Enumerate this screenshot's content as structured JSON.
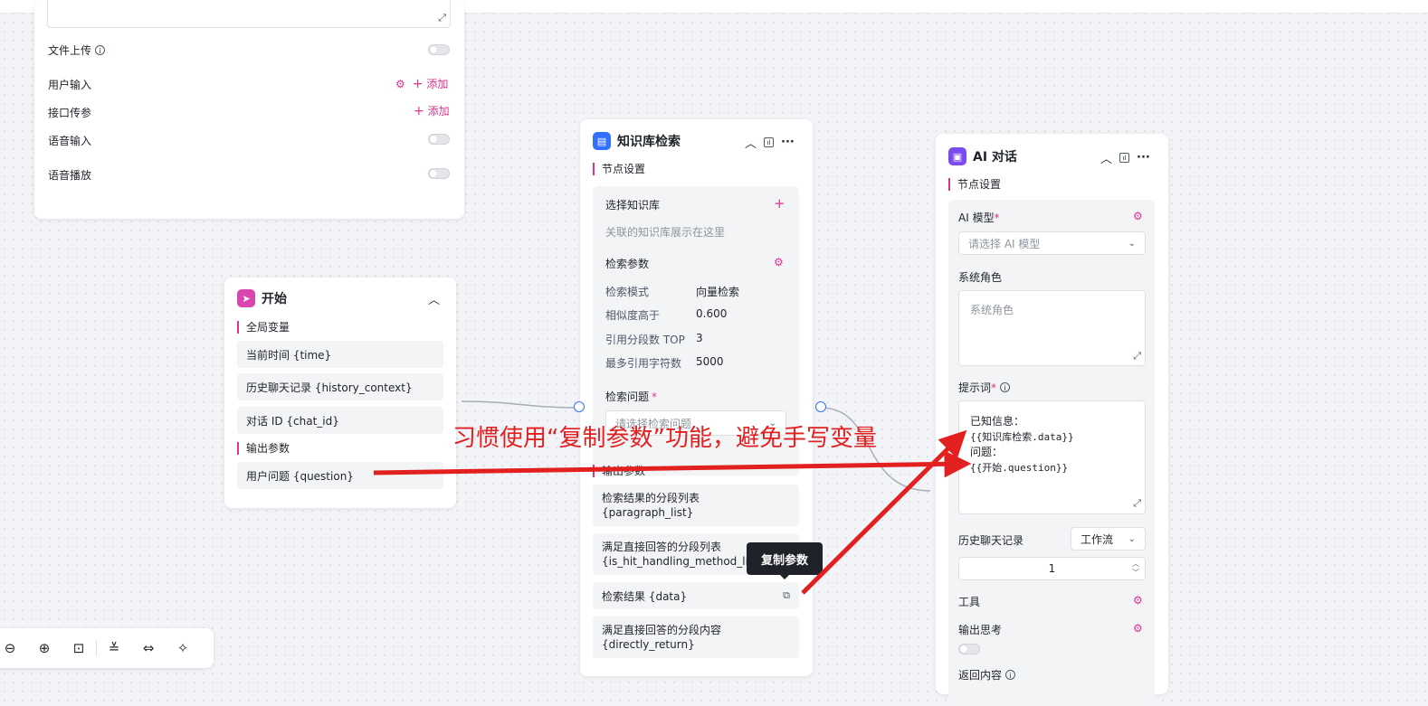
{
  "top_card": {
    "file_upload": "文件上传",
    "user_input": "用户输入",
    "api_params": "接口传参",
    "add": "添加",
    "voice_input": "语音输入",
    "voice_play": "语音播放"
  },
  "start_node": {
    "title": "开始",
    "global_vars": "全局变量",
    "vars": [
      "当前时间 {time}",
      "历史聊天记录 {history_context}",
      "对话 ID {chat_id}"
    ],
    "output_params": "输出参数",
    "outputs": [
      "用户问题 {question}"
    ]
  },
  "kb_node": {
    "title": "知识库检索",
    "node_settings": "节点设置",
    "select_kb": "选择知识库",
    "kb_placeholder": "关联的知识库展示在这里",
    "search_params": "检索参数",
    "params": [
      {
        "k": "检索模式",
        "v": "向量检索"
      },
      {
        "k": "相似度高于",
        "v": "0.600"
      },
      {
        "k": "引用分段数 TOP",
        "v": "3"
      },
      {
        "k": "最多引用字符数",
        "v": "5000"
      }
    ],
    "search_question": "检索问题",
    "search_question_placeholder": "请选择检索问题",
    "output_params": "输出参数",
    "outputs": [
      {
        "l1": "检索结果的分段列表",
        "l2": "{paragraph_list}"
      },
      {
        "l1": "满足直接回答的分段列表",
        "l2": "{is_hit_handling_method_list}"
      },
      {
        "l1": "检索结果 {data}",
        "l2": ""
      },
      {
        "l1": "满足直接回答的分段内容",
        "l2": "{directly_return}"
      }
    ]
  },
  "ai_node": {
    "title": "AI 对话",
    "node_settings": "节点设置",
    "model_label": "AI 模型",
    "model_placeholder": "请选择 AI 模型",
    "system_role": "系统角色",
    "system_role_placeholder": "系统角色",
    "prompt_label": "提示词",
    "prompt_lines": [
      "已知信息：",
      "{{知识库检索.data}}",
      "问题：",
      "{{开始.question}}"
    ],
    "history_label": "历史聊天记录",
    "history_value": "工作流",
    "history_count": "1",
    "tools": "工具",
    "output_thinking": "输出思考",
    "return_content": "返回内容"
  },
  "annotation": {
    "text": "习惯使用“复制参数”功能，避免手写变量",
    "tooltip": "复制参数",
    "color": "#e32020"
  },
  "colors": {
    "accent": "#e0338f",
    "port": "#3370ff",
    "start_icon": "#d946b0",
    "kb_icon": "#3370ff",
    "ai_icon": "#7a4bf0"
  }
}
